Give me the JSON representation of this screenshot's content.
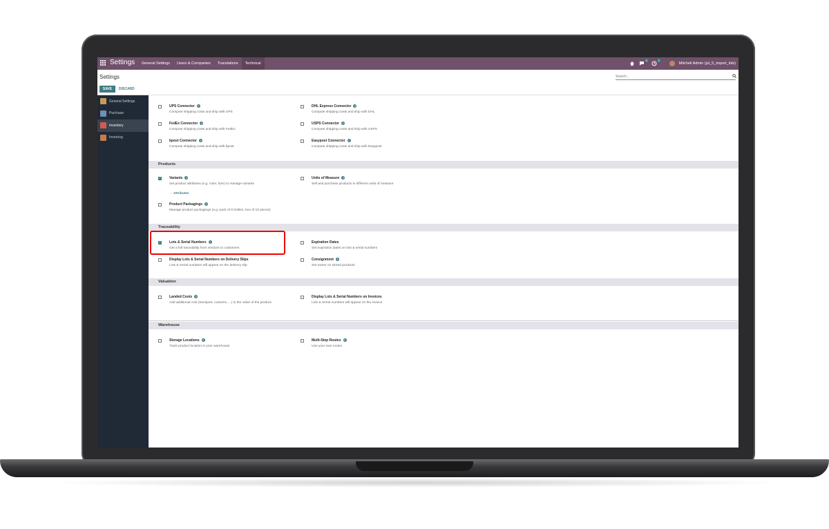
{
  "topbar": {
    "app_title": "Settings",
    "menu": [
      "General Settings",
      "Users & Companies",
      "Translations",
      "Technical"
    ],
    "active_menu": "Technical",
    "messages_count": "4",
    "activities_count": "2",
    "user": "Mitchell Admin (jul_5_import_lots)"
  },
  "control_panel": {
    "title": "Settings",
    "save_label": "SAVE",
    "discard_label": "DISCARD",
    "search_placeholder": "Search..."
  },
  "sidebar": {
    "items": [
      {
        "label": "General Settings",
        "color": "#c49a55"
      },
      {
        "label": "Purchase",
        "color": "#6f8fb4"
      },
      {
        "label": "Inventory",
        "color": "#d45a4f"
      },
      {
        "label": "Invoicing",
        "color": "#c77b47"
      }
    ],
    "active": "Inventory"
  },
  "shipping": {
    "ups": {
      "title": "UPS Connector",
      "desc": "Compute shipping costs and ship with UPS",
      "checked": false
    },
    "dhl": {
      "title": "DHL Express Connector",
      "desc": "Compute shipping costs and ship with DHL",
      "checked": false
    },
    "fedex": {
      "title": "FedEx Connector",
      "desc": "Compute shipping costs and ship with FedEx",
      "checked": false
    },
    "usps": {
      "title": "USPS Connector",
      "desc": "Compute shipping costs and ship with USPS",
      "checked": false
    },
    "bpost": {
      "title": "bpost Connector",
      "desc": "Compute shipping costs and ship with bpost",
      "checked": false
    },
    "easypost": {
      "title": "Easypost Connector",
      "desc": "Compute shipping costs and ship with Easypost",
      "checked": false
    }
  },
  "products": {
    "header": "Products",
    "variants": {
      "title": "Variants",
      "desc": "Set product attributes (e.g. color, size) to manage variants",
      "link": "Attributes",
      "checked": true
    },
    "uom": {
      "title": "Units of Measure",
      "desc": "Sell and purchase products in different units of measure",
      "checked": false
    },
    "packagings": {
      "title": "Product Packagings",
      "desc": "Manage product packagings (e.g. pack of 6 bottles, box of 10 pieces)",
      "checked": false
    }
  },
  "traceability": {
    "header": "Traceability",
    "lots": {
      "title": "Lots & Serial Numbers",
      "desc": "Get a full traceability from vendors to customers",
      "checked": true
    },
    "expiration": {
      "title": "Expiration Dates",
      "desc": "Set expiration dates on lots & serial numbers",
      "checked": false
    },
    "delivery_slips": {
      "title": "Display Lots & Serial Numbers on Delivery Slips",
      "desc": "Lots & Serial numbers will appear on the delivery slip",
      "checked": false
    },
    "consignment": {
      "title": "Consignment",
      "desc": "Set owner on stored products",
      "checked": false
    }
  },
  "valuation": {
    "header": "Valuation",
    "landed": {
      "title": "Landed Costs",
      "desc": "Add additional cost (transport, customs, ...) in the value of the product.",
      "checked": false
    },
    "invoices": {
      "title": "Display Lots & Serial Numbers on Invoices",
      "desc": "Lots & Serial numbers will appear on the invoice",
      "checked": false
    }
  },
  "warehouse": {
    "header": "Warehouse",
    "storage": {
      "title": "Storage Locations",
      "desc": "Track product location in your warehouse",
      "checked": false
    },
    "routes": {
      "title": "Multi-Step Routes",
      "desc": "Use your own routes",
      "checked": false
    }
  }
}
